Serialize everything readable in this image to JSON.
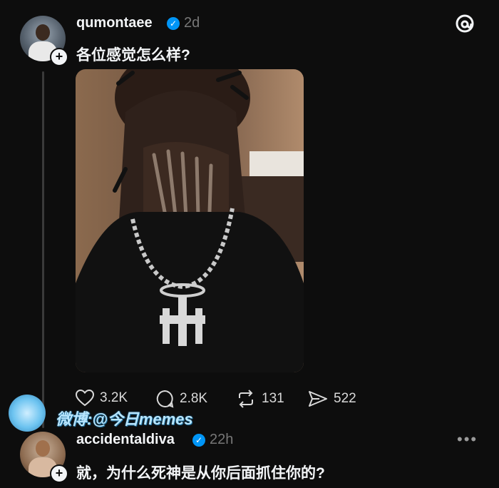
{
  "post": {
    "username": "qumontaee",
    "time": "2d",
    "text": "各位感觉怎么样?",
    "actions": {
      "likes": "3.2K",
      "comments": "2.8K",
      "reposts": "131",
      "shares": "522"
    }
  },
  "reply": {
    "username": "accidentaldiva",
    "time": "22h",
    "text": "就，为什么死神是从你后面抓住你的?"
  },
  "watermark": {
    "text": "微博:@今日memes"
  },
  "icons": {
    "app": "threads-logo-icon",
    "verified": "verified-badge-icon",
    "like": "heart-icon",
    "comment": "comment-icon",
    "repost": "repost-icon",
    "share": "share-icon",
    "more": "more-dots-icon"
  },
  "colors": {
    "background": "#0d0d0d",
    "verified": "#0095f6",
    "text": "#f3f5f7",
    "muted": "#777777"
  }
}
